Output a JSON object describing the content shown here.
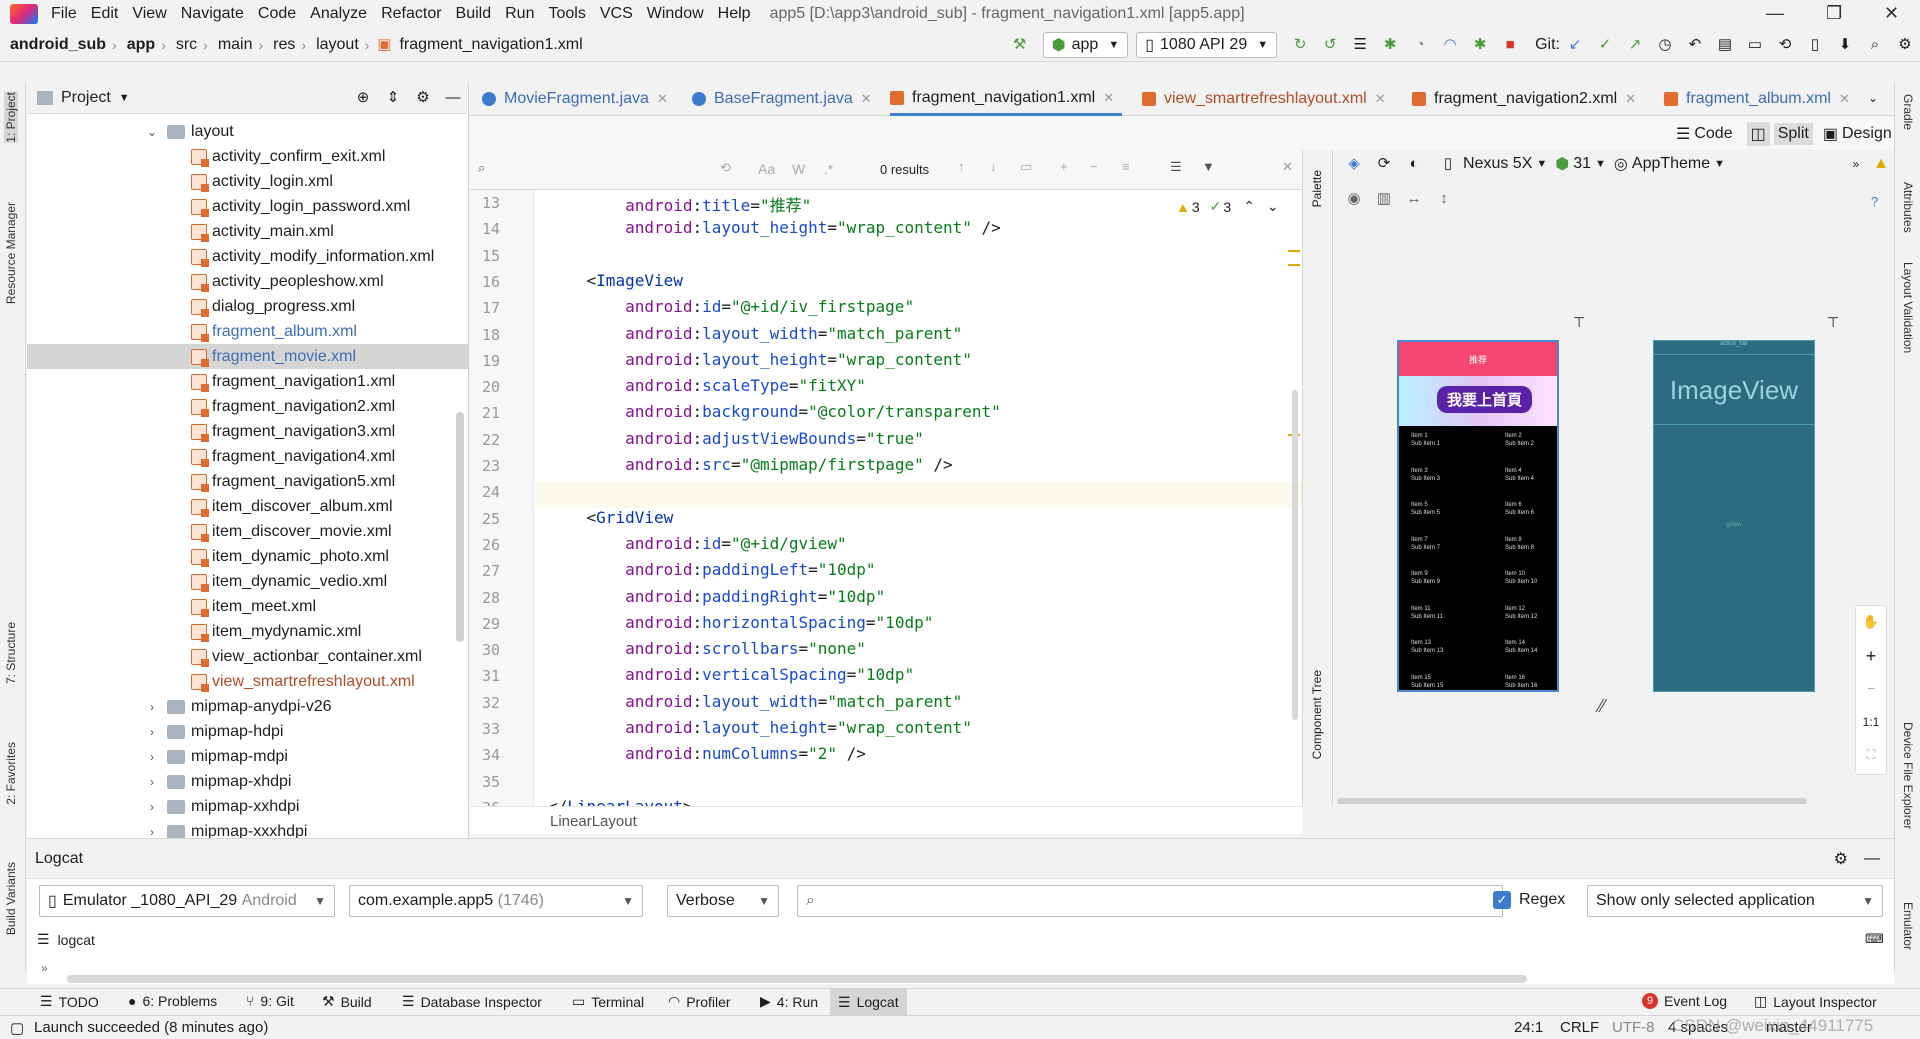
{
  "menu": {
    "items": [
      "File",
      "Edit",
      "View",
      "Navigate",
      "Code",
      "Analyze",
      "Refactor",
      "Build",
      "Run",
      "Tools",
      "VCS",
      "Window",
      "Help"
    ],
    "window_title": "app5 [D:\\app3\\android_sub] - fragment_navigation1.xml [app5.app]"
  },
  "breadcrumb": [
    "android_sub",
    "app",
    "src",
    "main",
    "res",
    "layout",
    "fragment_navigation1.xml"
  ],
  "toolbar": {
    "run_config": "app",
    "device": "1080 API 29",
    "git_label": "Git:"
  },
  "project_panel": {
    "title": "Project",
    "folder": "layout",
    "files": [
      "activity_confirm_exit.xml",
      "activity_login.xml",
      "activity_login_password.xml",
      "activity_main.xml",
      "activity_modify_information.xml",
      "activity_peopleshow.xml",
      "dialog_progress.xml",
      "fragment_album.xml",
      "fragment_movie.xml",
      "fragment_navigation1.xml",
      "fragment_navigation2.xml",
      "fragment_navigation3.xml",
      "fragment_navigation4.xml",
      "fragment_navigation5.xml",
      "item_discover_album.xml",
      "item_discover_movie.xml",
      "item_dynamic_photo.xml",
      "item_dynamic_vedio.xml",
      "item_meet.xml",
      "item_mydynamic.xml",
      "view_actionbar_container.xml",
      "view_smartrefreshlayout.xml"
    ],
    "folders": [
      "mipmap-anydpi-v26",
      "mipmap-hdpi",
      "mipmap-mdpi",
      "mipmap-xhdpi",
      "mipmap-xxhdpi",
      "mipmap-xxxhdpi"
    ]
  },
  "tabs": [
    "MovieFragment.java",
    "BaseFragment.java",
    "fragment_navigation1.xml",
    "view_smartrefreshlayout.xml",
    "fragment_navigation2.xml",
    "fragment_album.xml"
  ],
  "view_switch": {
    "code": "Code",
    "split": "Split",
    "design": "Design"
  },
  "search": {
    "results": "0 results",
    "case": "Aa",
    "word": "W",
    "regex": ".*"
  },
  "inspections": {
    "warnings": "3",
    "weak": "3"
  },
  "code_lines": [
    {
      "n": "13",
      "t": "        android:title=\"推荐\""
    },
    {
      "n": "14",
      "t": "        android:layout_height=\"wrap_content\" />"
    },
    {
      "n": "15",
      "t": ""
    },
    {
      "n": "16",
      "t": "    <ImageView"
    },
    {
      "n": "17",
      "t": "        android:id=\"@+id/iv_firstpage\""
    },
    {
      "n": "18",
      "t": "        android:layout_width=\"match_parent\""
    },
    {
      "n": "19",
      "t": "        android:layout_height=\"wrap_content\""
    },
    {
      "n": "20",
      "t": "        android:scaleType=\"fitXY\""
    },
    {
      "n": "21",
      "t": "        android:background=\"@color/transparent\""
    },
    {
      "n": "22",
      "t": "        android:adjustViewBounds=\"true\""
    },
    {
      "n": "23",
      "t": "        android:src=\"@mipmap/firstpage\" />"
    },
    {
      "n": "24",
      "t": ""
    },
    {
      "n": "25",
      "t": "    <GridView"
    },
    {
      "n": "26",
      "t": "        android:id=\"@+id/gview\""
    },
    {
      "n": "27",
      "t": "        android:paddingLeft=\"10dp\""
    },
    {
      "n": "28",
      "t": "        android:paddingRight=\"10dp\""
    },
    {
      "n": "29",
      "t": "        android:horizontalSpacing=\"10dp\""
    },
    {
      "n": "30",
      "t": "        android:scrollbars=\"none\""
    },
    {
      "n": "31",
      "t": "        android:verticalSpacing=\"10dp\""
    },
    {
      "n": "32",
      "t": "        android:layout_width=\"match_parent\""
    },
    {
      "n": "33",
      "t": "        android:layout_height=\"wrap_content\""
    },
    {
      "n": "34",
      "t": "        android:numColumns=\"2\" />"
    },
    {
      "n": "35",
      "t": ""
    },
    {
      "n": "36",
      "t": "</LinearLayout>"
    }
  ],
  "editor_breadcrumb": "LinearLayout",
  "design": {
    "device": "Nexus 5X",
    "api": "31",
    "theme": "AppTheme",
    "palette": "Palette",
    "component_tree": "Component Tree",
    "preview_title": "推荐",
    "banner_text": "我要上首頁",
    "blueprint_label": "ImageView",
    "blueprint_actionbar": "action_bar",
    "blueprint_grid": "gview",
    "zoom_fit": "1:1",
    "grid_items": [
      [
        "Item 1",
        "Sub Item 1"
      ],
      [
        "Item 2",
        "Sub Item 2"
      ],
      [
        "Item 3",
        "Sub Item 3"
      ],
      [
        "Item 4",
        "Sub Item 4"
      ],
      [
        "Item 5",
        "Sub Item 5"
      ],
      [
        "Item 6",
        "Sub Item 6"
      ],
      [
        "Item 7",
        "Sub Item 7"
      ],
      [
        "Item 8",
        "Sub Item 8"
      ],
      [
        "Item 9",
        "Sub Item 9"
      ],
      [
        "Item 10",
        "Sub Item 10"
      ],
      [
        "Item 11",
        "Sub Item 11"
      ],
      [
        "Item 12",
        "Sub Item 12"
      ],
      [
        "Item 13",
        "Sub Item 13"
      ],
      [
        "Item 14",
        "Sub Item 14"
      ],
      [
        "Item 15",
        "Sub Item 15"
      ],
      [
        "Item 16",
        "Sub Item 16"
      ]
    ]
  },
  "left_strip": [
    "1: Project",
    "Resource Manager",
    "7: Structure",
    "2: Favorites",
    "Build Variants"
  ],
  "right_strip": [
    "Gradle",
    "Attributes",
    "Layout Validation",
    "Device File Explorer",
    "Emulator"
  ],
  "logcat": {
    "title": "Logcat",
    "device": "Emulator _1080_API_29",
    "device_suffix": "Android",
    "process": "com.example.app5",
    "pid": "(1746)",
    "level": "Verbose",
    "regex_label": "Regex",
    "filter": "Show only selected application",
    "tab": "logcat",
    "search_placeholder": ""
  },
  "bottom_tabs": [
    "TODO",
    "6: Problems",
    "9: Git",
    "Build",
    "Database Inspector",
    "Terminal",
    "Profiler",
    "4: Run",
    "Logcat"
  ],
  "bottom_right": {
    "event_log": "Event Log",
    "event_count": "9",
    "layout_inspector": "Layout Inspector"
  },
  "status": {
    "message": "Launch succeeded (8 minutes ago)",
    "position": "24:1",
    "line_sep": "CRLF",
    "encoding": "UTF-8",
    "indent": "4 spaces",
    "branch": "master",
    "watermark": "CSDN @weixin_44911775"
  }
}
